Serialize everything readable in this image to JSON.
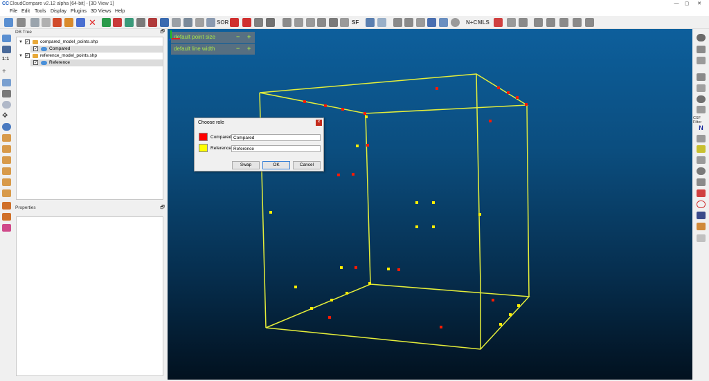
{
  "app": {
    "title": "CloudCompare v2.12 alpha [64-bit] - [3D View 1]",
    "logo": "CC"
  },
  "window_controls": [
    "—",
    "▢",
    "✕"
  ],
  "menu": [
    "File",
    "Edit",
    "Tools",
    "Display",
    "Plugins",
    "3D Views",
    "Help"
  ],
  "toolbar": {
    "sf_label": "SF",
    "sor_label": "SOR",
    "nc_label": "N+C",
    "mls_label": "MLS"
  },
  "db_tree": {
    "title": "DB Tree",
    "pin": "🗗",
    "items": [
      {
        "label": "compared_model_points.shp",
        "type": "folder"
      },
      {
        "label": "Compared",
        "type": "cloud"
      },
      {
        "label": "reference_model_points.shp",
        "type": "folder"
      },
      {
        "label": "Reference",
        "type": "cloud"
      }
    ]
  },
  "properties": {
    "title": "Properties",
    "pin": "🗗"
  },
  "view_overlay": {
    "point_size_label": "default point size",
    "line_width_label": "default line width",
    "minus": "−",
    "plus": "+"
  },
  "dialog": {
    "title": "Choose role",
    "close": "×",
    "rows": [
      {
        "label": "Compared",
        "value": "Compared",
        "color": "#ff0000"
      },
      {
        "label": "Reference",
        "value": "Reference",
        "color": "#ffff00"
      }
    ],
    "buttons": {
      "swap": "Swap",
      "ok": "OK",
      "cancel": "Cancel"
    }
  },
  "right_toolbar": {
    "csf_label": "CSF Filter",
    "north_label": "N"
  },
  "colors": {
    "bbox_line": "#e5ee3a",
    "point_red": "#ff1a00",
    "point_yellow": "#ffee00",
    "overlay_text": "#a8e54a"
  }
}
